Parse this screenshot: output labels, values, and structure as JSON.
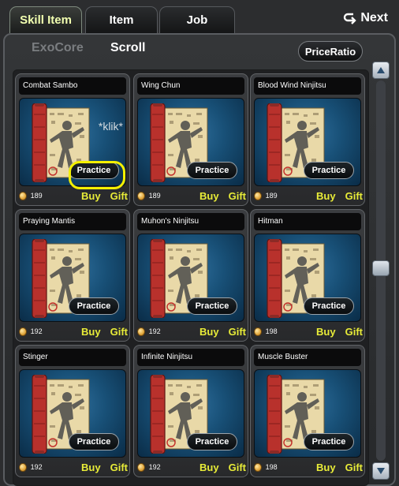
{
  "tabs": [
    {
      "label": "Skill Item",
      "active": true
    },
    {
      "label": "Item",
      "active": false
    },
    {
      "label": "Job",
      "active": false
    }
  ],
  "next_label": "Next",
  "subtabs": [
    {
      "label": "ExoCore",
      "active": false
    },
    {
      "label": "Scroll",
      "active": true
    }
  ],
  "price_ratio_label": "PriceRatio",
  "action_labels": {
    "practice": "Practice",
    "buy": "Buy",
    "gift": "Gift"
  },
  "annotation": "*klik*",
  "colors": {
    "tab_active_text": "#f2ffb0",
    "action_text": "#e8ec38",
    "highlight": "#f4f000"
  },
  "items": [
    {
      "name": "Combat Sambo",
      "price": "189"
    },
    {
      "name": "Wing Chun",
      "price": "189"
    },
    {
      "name": "Blood Wind Ninjitsu",
      "price": "189"
    },
    {
      "name": "Praying Mantis",
      "price": "192"
    },
    {
      "name": "Muhon's Ninjitsu",
      "price": "192"
    },
    {
      "name": "Hitman",
      "price": "198"
    },
    {
      "name": "Stinger",
      "price": "192"
    },
    {
      "name": "Infinite Ninjitsu",
      "price": "192"
    },
    {
      "name": "Muscle Buster",
      "price": "198"
    }
  ],
  "icons": {
    "next": "return-arrow-icon",
    "coin": "coin-icon",
    "scroll_up": "arrow-up-icon",
    "scroll_down": "arrow-down-icon"
  }
}
